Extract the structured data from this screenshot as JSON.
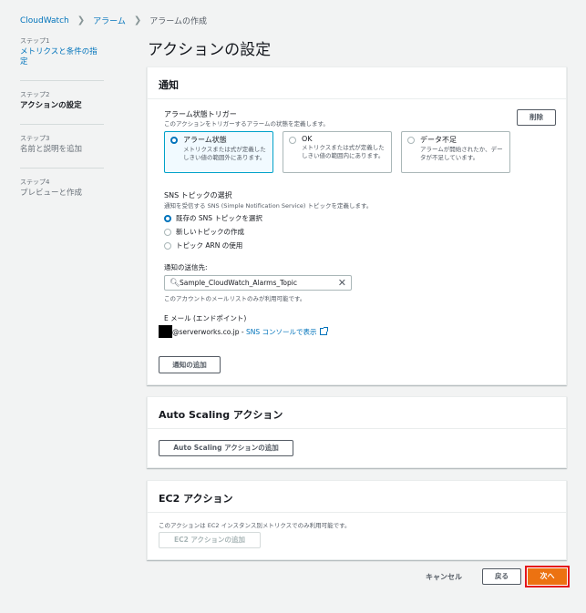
{
  "breadcrumb": {
    "items": [
      "CloudWatch",
      "アラーム",
      "アラームの作成"
    ]
  },
  "steps": [
    {
      "num": "ステップ1",
      "label": "メトリクスと条件の指定",
      "state": "link"
    },
    {
      "num": "ステップ2",
      "label": "アクションの設定",
      "state": "current"
    },
    {
      "num": "ステップ3",
      "label": "名前と説明を追加",
      "state": "dim"
    },
    {
      "num": "ステップ4",
      "label": "プレビューと作成",
      "state": "dim"
    }
  ],
  "page_title": "アクションの設定",
  "notification": {
    "header": "通知",
    "trigger_label": "アラーム状態トリガー",
    "trigger_desc": "このアクションをトリガーするアラームの状態を定義します。",
    "remove_label": "削除",
    "tiles": [
      {
        "title": "アラーム状態",
        "desc": "メトリクスまたは式が定義したしきい値の範囲外にあります。",
        "selected": true
      },
      {
        "title": "OK",
        "desc": "メトリクスまたは式が定義したしきい値の範囲内にあります。",
        "selected": false
      },
      {
        "title": "データ不足",
        "desc": "アラームが開始されたか、データが不足しています。",
        "selected": false
      }
    ],
    "sns_label": "SNS トピックの選択",
    "sns_desc": "通知を受信する SNS (Simple Notification Service) トピックを定義します。",
    "sns_options": [
      "既存の SNS トピックを選択",
      "新しいトピックの作成",
      "トピック ARN の使用"
    ],
    "send_to_label": "通知の送信先:",
    "send_to_value": "Sample_CloudWatch_Alarms_Topic",
    "send_to_hint": "このアカウントのメールリストのみが利用可能です。",
    "email_label": "E メール (エンドポイント)",
    "email_value": "@serverworks.co.jp",
    "email_sep": " - ",
    "sns_console_link": "SNS コンソールで表示",
    "add_notification": "通知の追加"
  },
  "autoscaling": {
    "header": "Auto Scaling アクション",
    "add_button": "Auto Scaling アクションの追加"
  },
  "ec2": {
    "header": "EC2 アクション",
    "desc": "このアクションは EC2 インスタンス別メトリクスでのみ利用可能です。",
    "add_button": "EC2 アクションの追加"
  },
  "footer": {
    "cancel": "キャンセル",
    "back": "戻る",
    "next": "次へ"
  },
  "colors": {
    "link": "#0073bb",
    "primary": "#ec7211",
    "highlight_border": "#e4141b"
  }
}
